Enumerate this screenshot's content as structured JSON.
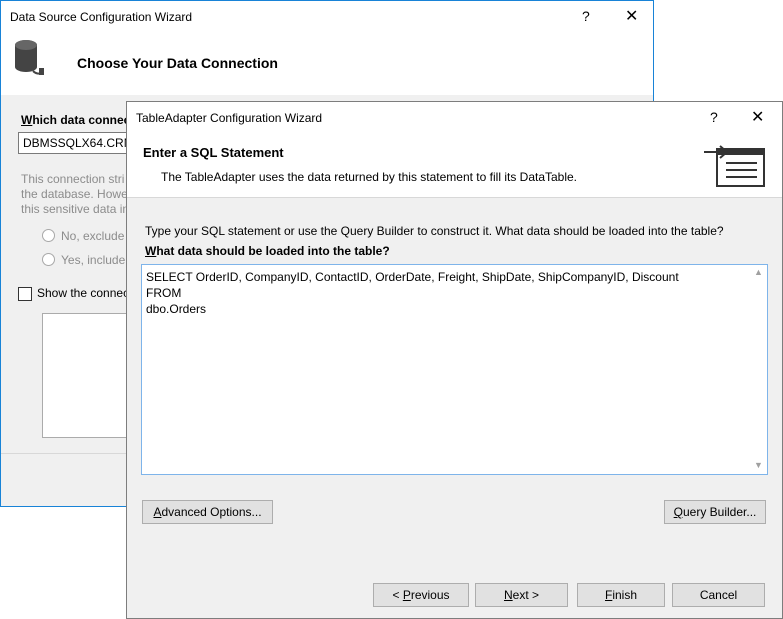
{
  "back_dialog": {
    "title": "Data Source Configuration Wizard",
    "help_glyph": "?",
    "close_glyph": "✕",
    "header_title": "Choose Your Data Connection",
    "connection_label_u": "W",
    "connection_label": "hich data connec",
    "connection_value": "DBMSSQLX64.CRM_",
    "desc_lines": [
      "This connection stri",
      "the database. Howe",
      "this sensitive data in"
    ],
    "radio_no": "No, exclude",
    "radio_yes": "Yes, include",
    "show_connection": "Show the connec"
  },
  "front_dialog": {
    "title": "TableAdapter Configuration Wizard",
    "help_glyph": "?",
    "close_glyph": "✕",
    "header_title": "Enter a SQL Statement",
    "header_subtitle": "The TableAdapter uses the data returned by this statement to fill its DataTable.",
    "instructions": "Type your SQL statement or use the Query Builder to construct it. What data should be loaded into the table?",
    "query_label_u": "W",
    "query_label": "hat data should be loaded into the table?",
    "sql_text": "SELECT OrderID, CompanyID, ContactID, OrderDate, Freight, ShipDate, ShipCompanyID, Discount FROM\ndbo.Orders",
    "buttons": {
      "advanced_u": "A",
      "advanced": "dvanced Options...",
      "query_builder_u": "Q",
      "query_builder": "uery Builder...",
      "previous_pre": "< ",
      "previous_u": "P",
      "previous": "revious",
      "next_u": "N",
      "next": "ext >",
      "finish_u": "F",
      "finish": "inish",
      "cancel": "Cancel"
    }
  }
}
